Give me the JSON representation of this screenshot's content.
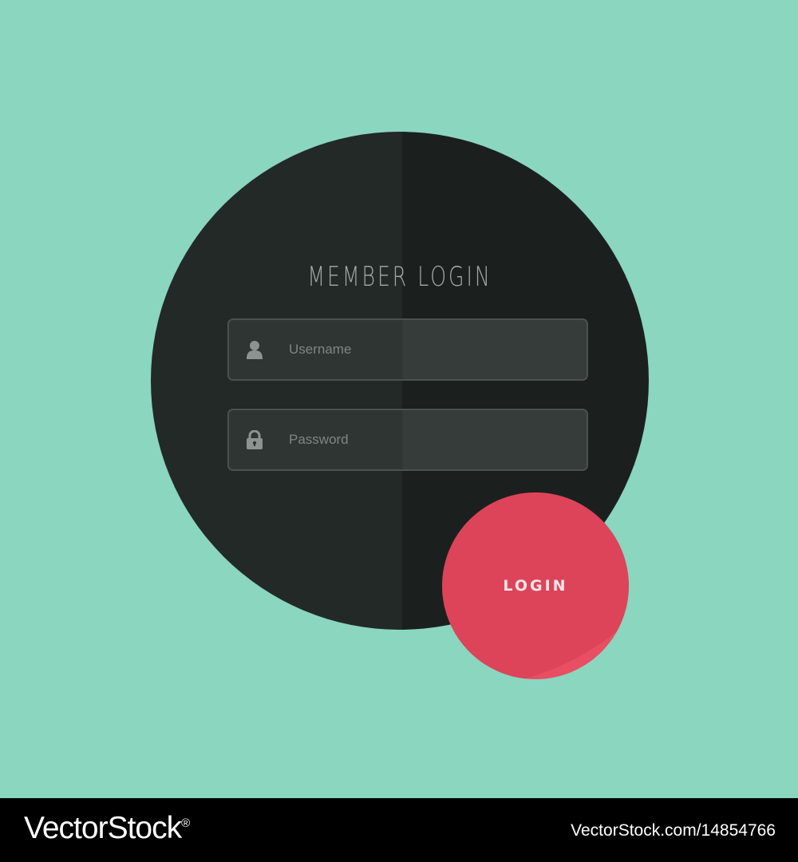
{
  "form": {
    "title": "MEMBER LOGIN",
    "username": {
      "placeholder": "Username",
      "value": "",
      "icon": "user-icon"
    },
    "password": {
      "placeholder": "Password",
      "value": "",
      "icon": "lock-icon"
    },
    "submit_label": "LOGIN"
  },
  "footer": {
    "brand": "VectorStock",
    "brand_mark": "®",
    "credit": "VectorStock.com/14854766"
  },
  "colors": {
    "background": "#8ad6bf",
    "card": "#232927",
    "button": "#e94e62",
    "footer": "#000000"
  }
}
